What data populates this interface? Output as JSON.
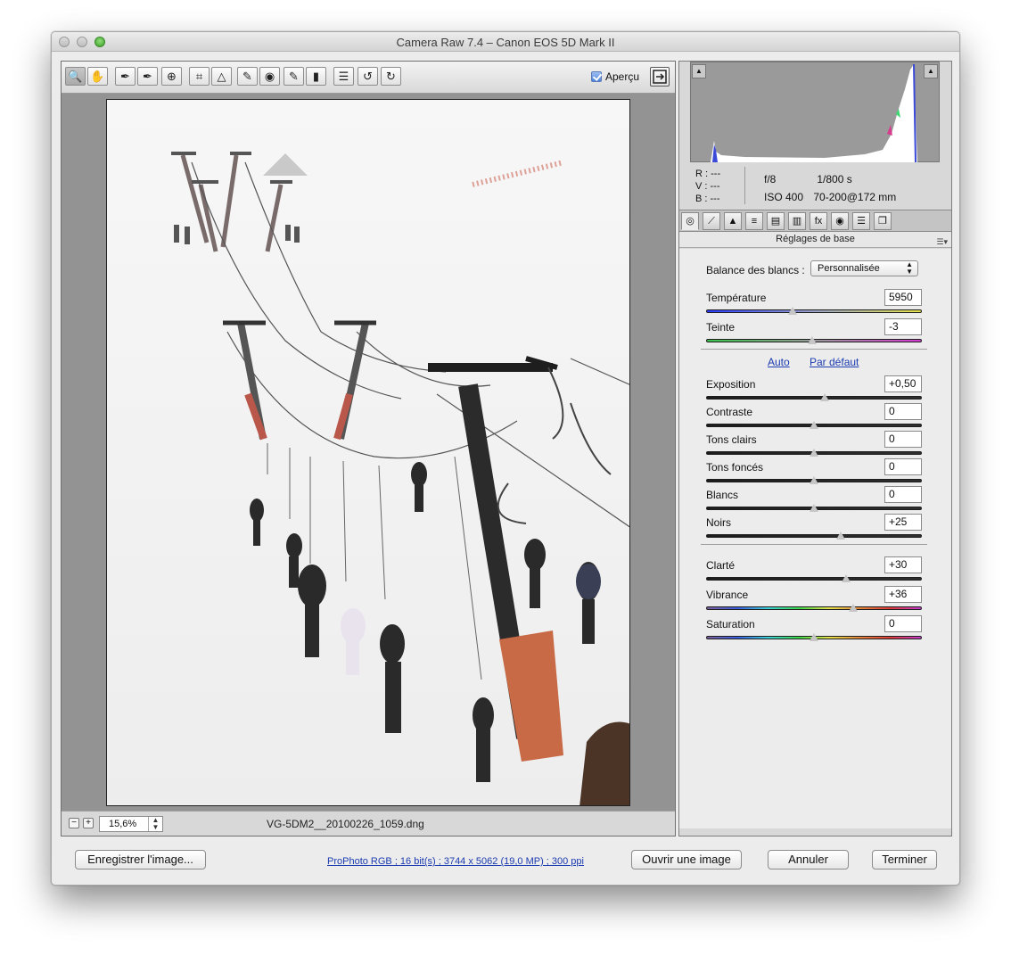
{
  "window": {
    "title": "Camera Raw 7.4  –  Canon EOS 5D Mark II"
  },
  "toolbar": {
    "tools": [
      {
        "icon": "zoom-icon",
        "glyph": "🔍"
      },
      {
        "icon": "hand-icon",
        "glyph": "✋"
      },
      {
        "icon": "white-balance-icon",
        "glyph": "✒"
      },
      {
        "icon": "color-sampler-icon",
        "glyph": "✒"
      },
      {
        "icon": "target-adjust-icon",
        "glyph": "⊕"
      },
      {
        "icon": "crop-icon",
        "glyph": "⌗"
      },
      {
        "icon": "straighten-icon",
        "glyph": "△"
      },
      {
        "icon": "spot-removal-icon",
        "glyph": "✎"
      },
      {
        "icon": "red-eye-icon",
        "glyph": "◉"
      },
      {
        "icon": "adjustment-brush-icon",
        "glyph": "✎"
      },
      {
        "icon": "graduated-filter-icon",
        "glyph": "▮"
      },
      {
        "icon": "preferences-icon",
        "glyph": "☰"
      },
      {
        "icon": "rotate-ccw-icon",
        "glyph": "↺"
      },
      {
        "icon": "rotate-cw-icon",
        "glyph": "↻"
      }
    ],
    "preview_label": "Aperçu"
  },
  "status": {
    "zoom_minus": "−",
    "zoom_plus": "+",
    "zoom_value": "15,6%",
    "filename": "VG-5DM2__20100226_1059.dng"
  },
  "readout": {
    "r_label": "R :",
    "v_label": "V :",
    "b_label": "B :",
    "r": "---",
    "v": "---",
    "b": "---",
    "aperture": "f/8",
    "shutter": "1/800 s",
    "iso": "ISO 400",
    "lens": "70-200@172 mm"
  },
  "panel": {
    "section_title": "Réglages de base",
    "wb_label": "Balance des blancs :",
    "wb_value": "Personnalisée",
    "auto_label": "Auto",
    "default_label": "Par défaut",
    "sliders": [
      {
        "key": "temperature",
        "label": "Température",
        "value": "5950",
        "pos": 0.4,
        "track": "temp"
      },
      {
        "key": "tint",
        "label": "Teinte",
        "value": "-3",
        "pos": 0.49,
        "track": "tint"
      },
      {
        "key": "exposure",
        "label": "Exposition",
        "value": "+0,50",
        "pos": 0.55,
        "track": "gray"
      },
      {
        "key": "contrast",
        "label": "Contraste",
        "value": "0",
        "pos": 0.5,
        "track": "gray"
      },
      {
        "key": "highlights",
        "label": "Tons clairs",
        "value": "0",
        "pos": 0.5,
        "track": "gray"
      },
      {
        "key": "shadows",
        "label": "Tons foncés",
        "value": "0",
        "pos": 0.5,
        "track": "gray"
      },
      {
        "key": "whites",
        "label": "Blancs",
        "value": "0",
        "pos": 0.5,
        "track": "gray"
      },
      {
        "key": "blacks",
        "label": "Noirs",
        "value": "+25",
        "pos": 0.625,
        "track": "gray"
      },
      {
        "key": "clarity",
        "label": "Clarté",
        "value": "+30",
        "pos": 0.65,
        "track": "gray"
      },
      {
        "key": "vibrance",
        "label": "Vibrance",
        "value": "+36",
        "pos": 0.68,
        "track": "rainbow"
      },
      {
        "key": "saturation",
        "label": "Saturation",
        "value": "0",
        "pos": 0.5,
        "track": "rainbow"
      }
    ]
  },
  "footer": {
    "save_label": "Enregistrer l'image...",
    "info_link": "ProPhoto RGB ; 16 bit(s) ; 3744 x 5062 (19,0 MP) ; 300 ppi",
    "open_label": "Ouvrir une image",
    "cancel_label": "Annuler",
    "done_label": "Terminer"
  },
  "colors": {
    "link": "#1b3bb0",
    "window_bg": "#ececec"
  }
}
